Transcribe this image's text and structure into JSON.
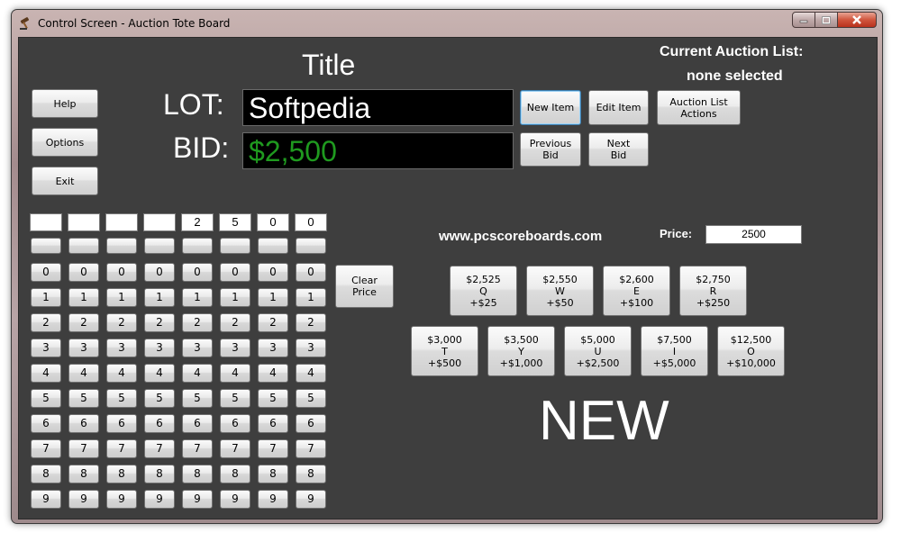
{
  "window": {
    "title": "Control Screen - Auction Tote Board"
  },
  "header": {
    "title": "Title",
    "auction_list_label": "Current Auction List:",
    "auction_list_value": "none selected"
  },
  "left_buttons": {
    "help": "Help",
    "options": "Options",
    "exit": "Exit"
  },
  "lot": {
    "label": "LOT:",
    "value": "Softpedia",
    "color": "#ffffff"
  },
  "bid": {
    "label": "BID:",
    "value": "$2,500",
    "color": "#1f9a1f"
  },
  "item_buttons": {
    "new_item": "New Item",
    "edit_item": "Edit Item",
    "auction_list_actions_1": "Auction List",
    "auction_list_actions_2": "Actions",
    "previous_bid_1": "Previous",
    "previous_bid_2": "Bid",
    "next_bid_1": "Next",
    "next_bid_2": "Bid"
  },
  "digit_display": [
    "",
    "",
    "",
    "",
    "2",
    "5",
    "0",
    "0"
  ],
  "digit_rows": [
    "",
    "0",
    "1",
    "2",
    "3",
    "4",
    "5",
    "6",
    "7",
    "8",
    "9"
  ],
  "clear_price": {
    "line1": "Clear",
    "line2": "Price"
  },
  "website": "www.pcscoreboards.com",
  "price": {
    "label": "Price:",
    "value": "2500"
  },
  "quick_bids_row1": [
    {
      "amount": "$2,525",
      "key": "Q",
      "increment": "+$25"
    },
    {
      "amount": "$2,550",
      "key": "W",
      "increment": "+$50"
    },
    {
      "amount": "$2,600",
      "key": "E",
      "increment": "+$100"
    },
    {
      "amount": "$2,750",
      "key": "R",
      "increment": "+$250"
    }
  ],
  "quick_bids_row2": [
    {
      "amount": "$3,000",
      "key": "T",
      "increment": "+$500"
    },
    {
      "amount": "$3,500",
      "key": "Y",
      "increment": "+$1,000"
    },
    {
      "amount": "$5,000",
      "key": "U",
      "increment": "+$2,500"
    },
    {
      "amount": "$7,500",
      "key": "I",
      "increment": "+$5,000"
    },
    {
      "amount": "$12,500",
      "key": "O",
      "increment": "+$10,000"
    }
  ],
  "status_text": "NEW",
  "icons": {
    "app": "gavel-icon",
    "minimize": "minimize-icon",
    "maximize": "maximize-icon",
    "close": "close-icon"
  }
}
